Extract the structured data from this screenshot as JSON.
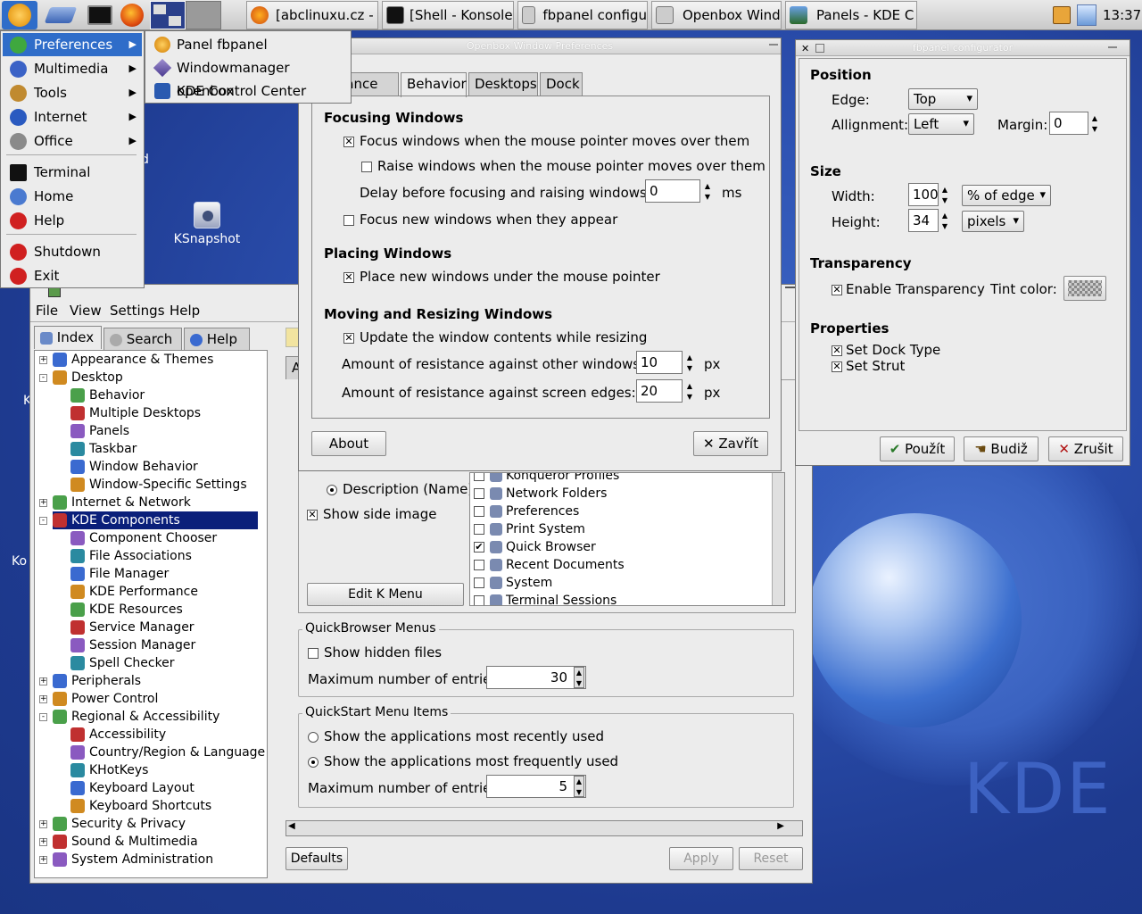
{
  "taskbar": {
    "tasks": [
      "[abclinuxu.cz -",
      "[Shell - Konsole",
      "fbpanel configu",
      "Openbox Wind",
      "Panels - KDE C"
    ],
    "clock": "13:37"
  },
  "desktop": {
    "icons": [
      {
        "label": "KSnapshot"
      }
    ],
    "watermark": "KDE",
    "clipped_labels": [
      "d",
      "K",
      "Ko"
    ]
  },
  "start_menu": {
    "items": [
      {
        "label": "Preferences",
        "icon": "preferences-icon",
        "submenu": true
      },
      {
        "label": "Multimedia",
        "icon": "multimedia-icon",
        "submenu": true
      },
      {
        "label": "Tools",
        "icon": "tools-icon",
        "submenu": true
      },
      {
        "label": "Internet",
        "icon": "internet-icon",
        "submenu": true
      },
      {
        "label": "Office",
        "icon": "office-icon",
        "submenu": true
      },
      {
        "label": "Terminal",
        "icon": "terminal-icon",
        "submenu": false
      },
      {
        "label": "Home",
        "icon": "home-icon",
        "submenu": false
      },
      {
        "label": "Help",
        "icon": "help-icon",
        "submenu": false
      },
      {
        "label": "Shutdown",
        "icon": "shutdown-icon",
        "submenu": false
      },
      {
        "label": "Exit",
        "icon": "exit-icon",
        "submenu": false
      }
    ],
    "submenu": [
      "Panel fbpanel",
      "Windowmanager openbox",
      "KDE Control Center"
    ]
  },
  "openbox": {
    "title": "Openbox Window Preferences",
    "tabs": [
      "arance",
      "Behavior",
      "Desktops",
      "Dock"
    ],
    "focusing": {
      "heading": "Focusing Windows",
      "focus_mouse": "Focus windows when the mouse pointer moves over them",
      "raise_mouse": "Raise windows when the mouse pointer moves over them",
      "delay_label": "Delay before focusing and raising windows:",
      "delay_value": "0",
      "delay_unit": "ms",
      "focus_new": "Focus new windows when they appear"
    },
    "placing": {
      "heading": "Placing Windows",
      "under_mouse": "Place new windows under the mouse pointer"
    },
    "moving": {
      "heading": "Moving and Resizing Windows",
      "update_contents": "Update the window contents while resizing",
      "res_windows_label": "Amount of resistance against other windows:",
      "res_windows_value": "10",
      "res_edges_label": "Amount of resistance against screen edges:",
      "res_edges_value": "20",
      "unit": "px"
    },
    "about": "About",
    "close": "Zavřít"
  },
  "fbpanel": {
    "title": "fbpanel configurator",
    "position": {
      "heading": "Position",
      "edge_label": "Edge:",
      "edge_value": "Top",
      "align_label": "Allignment:",
      "align_value": "Left",
      "margin_label": "Margin:",
      "margin_value": "0"
    },
    "size": {
      "heading": "Size",
      "width_label": "Width:",
      "width_value": "100",
      "width_unit": "% of edge",
      "height_label": "Height:",
      "height_value": "34",
      "height_unit": "pixels"
    },
    "transparency": {
      "heading": "Transparency",
      "enable": "Enable Transparency",
      "tint_label": "Tint color:"
    },
    "properties": {
      "heading": "Properties",
      "dock": "Set Dock Type",
      "strut": "Set Strut"
    },
    "buttons": {
      "apply": "Použít",
      "ok": "Budiž",
      "cancel": "Zrušit"
    }
  },
  "kcontrol": {
    "menu": [
      "File",
      "View",
      "Settings",
      "Help"
    ],
    "side_tabs": [
      "Index",
      "Search",
      "Help"
    ],
    "tree": [
      {
        "label": "Appearance & Themes",
        "level": 0,
        "expander": "+"
      },
      {
        "label": "Desktop",
        "level": 0,
        "expander": "-"
      },
      {
        "label": "Behavior",
        "level": 1
      },
      {
        "label": "Multiple Desktops",
        "level": 1
      },
      {
        "label": "Panels",
        "level": 1
      },
      {
        "label": "Taskbar",
        "level": 1
      },
      {
        "label": "Window Behavior",
        "level": 1
      },
      {
        "label": "Window-Specific Settings",
        "level": 1
      },
      {
        "label": "Internet & Network",
        "level": 0,
        "expander": "+"
      },
      {
        "label": "KDE Components",
        "level": 0,
        "expander": "-",
        "selected": true
      },
      {
        "label": "Component Chooser",
        "level": 1
      },
      {
        "label": "File Associations",
        "level": 1
      },
      {
        "label": "File Manager",
        "level": 1
      },
      {
        "label": "KDE Performance",
        "level": 1
      },
      {
        "label": "KDE Resources",
        "level": 1
      },
      {
        "label": "Service Manager",
        "level": 1
      },
      {
        "label": "Session Manager",
        "level": 1
      },
      {
        "label": "Spell Checker",
        "level": 1
      },
      {
        "label": "Peripherals",
        "level": 0,
        "expander": "+"
      },
      {
        "label": "Power Control",
        "level": 0,
        "expander": "+"
      },
      {
        "label": "Regional & Accessibility",
        "level": 0,
        "expander": "-"
      },
      {
        "label": "Accessibility",
        "level": 1
      },
      {
        "label": "Country/Region & Language",
        "level": 1
      },
      {
        "label": "KHotKeys",
        "level": 1
      },
      {
        "label": "Keyboard Layout",
        "level": 1
      },
      {
        "label": "Keyboard Shortcuts",
        "level": 1
      },
      {
        "label": "Security & Privacy",
        "level": 0,
        "expander": "+"
      },
      {
        "label": "Sound & Multimedia",
        "level": 0,
        "expander": "+"
      },
      {
        "label": "System Administration",
        "level": 0,
        "expander": "+"
      }
    ],
    "content": {
      "tab_partial": "A",
      "description_radio": "Description (Name)",
      "side_image": "Show side image",
      "edit_menu": "Edit K Menu",
      "menu_list": [
        {
          "label": "Konqueror Profiles",
          "checked": false
        },
        {
          "label": "Network Folders",
          "checked": false
        },
        {
          "label": "Preferences",
          "checked": false
        },
        {
          "label": "Print System",
          "checked": false
        },
        {
          "label": "Quick Browser",
          "checked": true
        },
        {
          "label": "Recent Documents",
          "checked": false
        },
        {
          "label": "System",
          "checked": false
        },
        {
          "label": "Terminal Sessions",
          "checked": false
        }
      ],
      "quickbrowser": {
        "title": "QuickBrowser Menus",
        "hidden": "Show hidden files",
        "max_label": "Maximum number of entries:",
        "max_value": "30"
      },
      "quickstart": {
        "title": "QuickStart Menu Items",
        "recent": "Show the applications most recently used",
        "frequent": "Show the applications most frequently used",
        "max_label": "Maximum number of entries:",
        "max_value": "5"
      }
    },
    "bottom": {
      "defaults": "Defaults",
      "apply": "Apply",
      "reset": "Reset"
    }
  },
  "colors": {
    "desktop": "#233e94",
    "menu_highlight": "#2f6dc9",
    "tree_selection": "#0a1f7a"
  }
}
